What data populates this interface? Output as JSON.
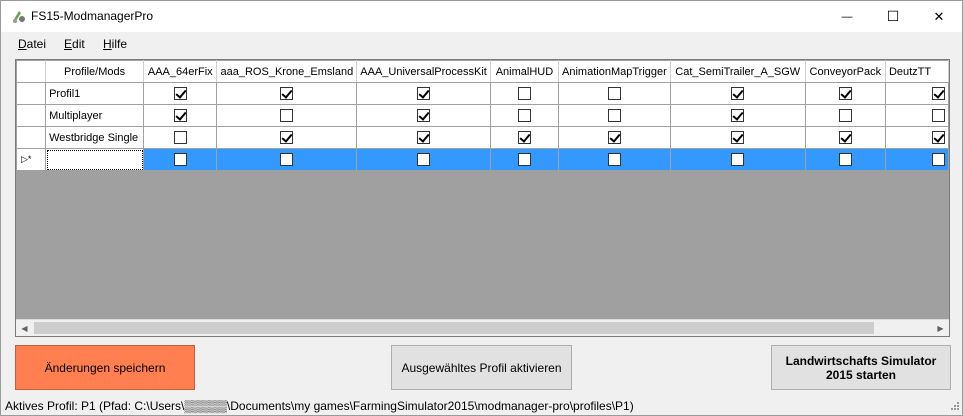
{
  "window": {
    "title": "FS15-ModmanagerPro",
    "minimize_glyph": "—",
    "maximize_glyph": "☐",
    "close_glyph": "✕"
  },
  "menu": {
    "items": [
      "Datei",
      "Edit",
      "Hilfe"
    ]
  },
  "grid": {
    "corner_label": "",
    "name_header": "Profile/Mods",
    "columns": [
      "AAA_64erFix",
      "aaa_ROS_Krone_Emsland",
      "AAA_UniversalProcessKit",
      "AnimalHUD",
      "AnimationMapTrigger",
      "Cat_SemiTrailer_A_SGW",
      "ConveyorPack",
      "DeutzTT"
    ],
    "rows": [
      {
        "name": "Profil1",
        "values": [
          true,
          true,
          true,
          false,
          false,
          true,
          true,
          true
        ]
      },
      {
        "name": "Multiplayer",
        "values": [
          true,
          false,
          true,
          false,
          false,
          true,
          false,
          false
        ]
      },
      {
        "name": "Westbridge Single",
        "values": [
          false,
          true,
          true,
          true,
          true,
          true,
          true,
          true
        ]
      }
    ],
    "new_row": {
      "marker": "▷*",
      "name": "",
      "values": [
        false,
        false,
        false,
        false,
        false,
        false,
        false,
        false
      ]
    },
    "scroll_left": "◀",
    "scroll_right": "▶"
  },
  "buttons": {
    "save": "Änderungen speichern",
    "activate": "Ausgewähltes Profil aktivieren",
    "start_line1": "Landwirtschafts Simulator",
    "start_line2": "2015 starten"
  },
  "status": {
    "text": "Aktives Profil: P1 (Pfad: C:\\Users\\▒▒▒▒▒\\Documents\\my games\\FarmingSimulator2015\\modmanager-pro\\profiles\\P1)"
  },
  "colors": {
    "accent_selection": "#3399ff",
    "save_button": "#ff7f50"
  }
}
